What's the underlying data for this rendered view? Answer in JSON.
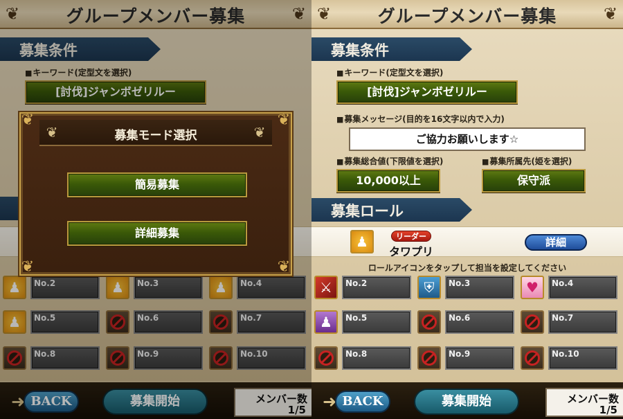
{
  "screen_title": "グループメンバー募集",
  "section_conditions": "募集条件",
  "label_keyword": "キーワード(定型文を選択)",
  "keyword_value": "[討伐]ジャンボゼリルー",
  "label_message": "募集メッセージ(目的を16文字以内で入力)",
  "message_value": "ご協力お願いします☆",
  "label_total": "募集総合値(下限値を選択)",
  "total_value": "10,000以上",
  "label_affiliation": "募集所属先(姫を選択)",
  "affiliation_value": "保守派",
  "section_roles": "募集ロール",
  "leader": {
    "badge": "リーダー",
    "name": "タワプリ",
    "detail_label": "詳細"
  },
  "hint": "ロールアイコンをタップして担当を設定してください",
  "slots": [
    {
      "no": "No.2",
      "role": "attack"
    },
    {
      "no": "No.3",
      "role": "defense"
    },
    {
      "no": "No.4",
      "role": "heal"
    },
    {
      "no": "No.5",
      "role": "support"
    },
    {
      "no": "No.6",
      "role": "empty"
    },
    {
      "no": "No.7",
      "role": "empty"
    },
    {
      "no": "No.8",
      "role": "empty"
    },
    {
      "no": "No.9",
      "role": "empty"
    },
    {
      "no": "No.10",
      "role": "empty"
    }
  ],
  "left_slots": [
    {
      "no": "No.2",
      "role": "leader"
    },
    {
      "no": "No.3",
      "role": "leader"
    },
    {
      "no": "No.4",
      "role": "leader"
    },
    {
      "no": "No.5",
      "role": "leader"
    },
    {
      "no": "No.6",
      "role": "empty"
    },
    {
      "no": "No.7",
      "role": "empty"
    },
    {
      "no": "No.8",
      "role": "empty"
    },
    {
      "no": "No.9",
      "role": "empty"
    },
    {
      "no": "No.10",
      "role": "empty"
    }
  ],
  "footer": {
    "back_label": "BACK",
    "start_label": "募集開始",
    "member_count_label": "メンバー数",
    "member_count_value": "1/5"
  },
  "modal": {
    "title": "募集モード選択",
    "simple_label": "簡易募集",
    "detail_label": "詳細募集"
  },
  "icons": {
    "title_ornament": "scroll-ornament-icon",
    "back": "back-arrow-icon",
    "leader": "leader-role-icon",
    "attack": "attack-role-icon",
    "defense": "defense-role-icon",
    "heal": "heal-role-icon",
    "support": "support-role-icon",
    "empty": "no-sign-icon"
  }
}
